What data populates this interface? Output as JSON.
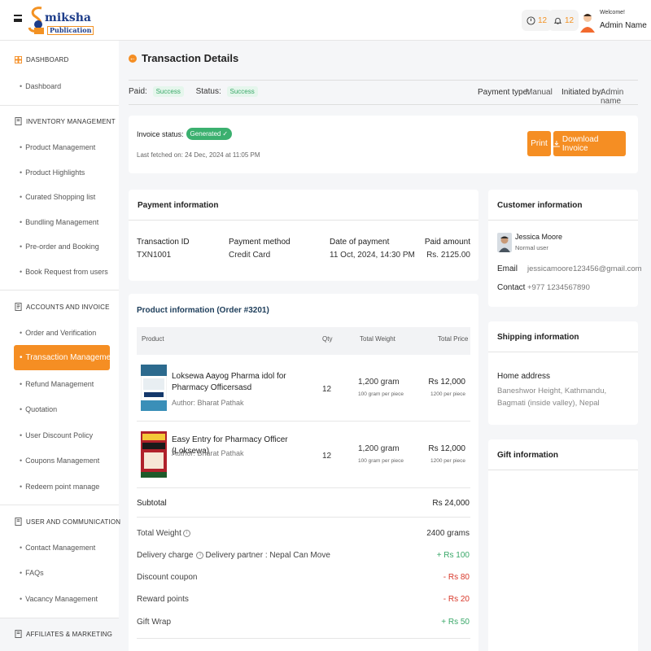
{
  "header": {
    "logo_text": "miksha",
    "logo_sub": "Publication",
    "notif_count_1": "12",
    "notif_count_2": "12",
    "welcome": "Welcome!",
    "admin_name": "Admin Name"
  },
  "sidebar": {
    "dashboard": {
      "title": "DASHBOARD",
      "items": [
        "Dashboard"
      ]
    },
    "inventory": {
      "title": "INVENTORY MANAGEMENT",
      "items": [
        "Product Management",
        "Product Highlights",
        "Curated Shopping list",
        "Bundling Management",
        "Pre-order and Booking",
        "Book Request from users"
      ]
    },
    "accounts": {
      "title": "ACCOUNTS AND INVOICE",
      "items": [
        "Order and Verification",
        "Transaction Management",
        "Refund Management",
        "Quotation",
        "User Discount Policy",
        "Coupons Management",
        "Redeem point manage"
      ]
    },
    "user": {
      "title": "USER AND COMMUNICATION",
      "items": [
        "Contact Management",
        "FAQs",
        "Vacancy Management"
      ]
    },
    "affiliates": {
      "title": "AFFILIATES & MARKETING"
    }
  },
  "page": {
    "title": "Transaction Details",
    "paid_label": "Paid:",
    "paid_value": "Success",
    "status_label": "Status:",
    "status_value": "Success",
    "payment_type_label": "Payment type:",
    "payment_type_value": "Manual",
    "initiated_label": "Initiated by:",
    "initiated_value": "Admin name"
  },
  "invoice": {
    "status_label": "Invoice status:",
    "status_value": "Generated",
    "last_fetched": "Last fetched on: 24 Dec, 2024 at 11:05 PM",
    "print": "Print",
    "download": "Download Invoice"
  },
  "payment": {
    "title": "Payment information",
    "transaction_id_label": "Transaction ID",
    "transaction_id": "TXN1001",
    "method_label": "Payment method",
    "method": "Credit Card",
    "date_label": "Date of payment",
    "date": "11 Oct, 2024, 14:30 PM",
    "amount_label": "Paid amount",
    "amount": "Rs. 2125.00"
  },
  "products": {
    "title": "Product information (Order #3201)",
    "headers": {
      "product": "Product",
      "qty": "Qty",
      "weight": "Total Weight",
      "price": "Total Price"
    },
    "rows": [
      {
        "name": "Loksewa Aayog Pharma idol for Pharmacy Officersasd",
        "author": "Author: Bharat Pathak",
        "qty": "12",
        "weight": "1,200 gram",
        "weight_sub": "100 gram per piece",
        "price": "Rs 12,000",
        "price_sub": "1200 per piece"
      },
      {
        "name": "Easy Entry for Pharmacy Officer (Loksewa)",
        "author": "Author: Bharat Pathak",
        "qty": "12",
        "weight": "1,200 gram",
        "weight_sub": "100 gram per piece",
        "price": "Rs 12,000",
        "price_sub": "1200 per piece"
      }
    ],
    "subtotal_label": "Subtotal",
    "subtotal": "Rs 24,000",
    "total_weight_label": "Total Weight",
    "total_weight": "2400 grams",
    "delivery_label": "Delivery charge",
    "delivery_partner": "Delivery partner : Nepal Can Move",
    "delivery": "+ Rs 100",
    "discount_label": "Discount coupon",
    "discount": "- Rs 80",
    "reward_label": "Reward points",
    "reward": "- Rs 20",
    "gift_label": "Gift Wrap",
    "gift": "+ Rs 50"
  },
  "customer": {
    "title": "Customer information",
    "name": "Jessica Moore",
    "role": "Normal user",
    "email_label": "Email",
    "email": "jessicamoore123456@gmail.com",
    "contact_label": "Contact",
    "contact": "+977 1234567890"
  },
  "shipping": {
    "title": "Shipping information",
    "address_label": "Home address",
    "address": "Baneshwor Height, Kathmandu, Bagmati (inside valley), Nepal"
  },
  "gift": {
    "title": "Gift information"
  },
  "colors": {
    "accent": "#f58e23",
    "success": "#3aa869",
    "danger": "#d8382a"
  }
}
